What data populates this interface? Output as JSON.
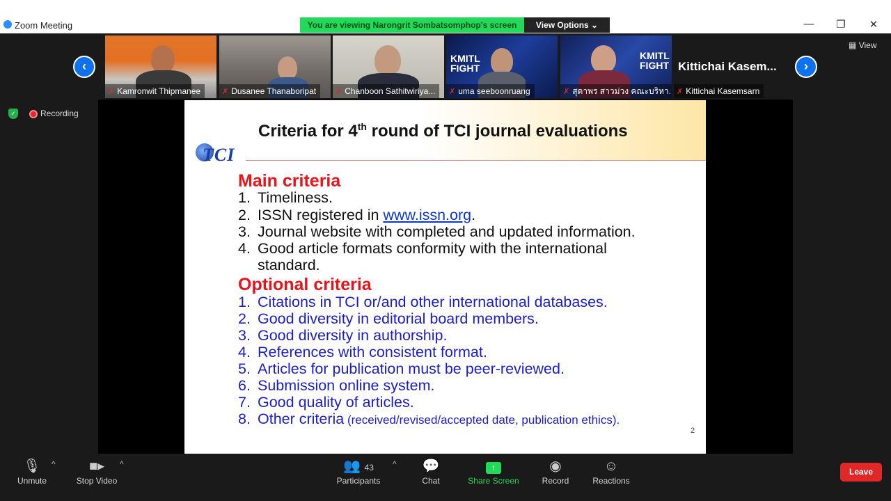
{
  "window": {
    "title": "Zoom Meeting",
    "minimize": "—",
    "restore": "❐",
    "close": "✕"
  },
  "banner": {
    "viewing": "You are viewing Narongrit Sombatsomphop's screen",
    "view_options": "View Options ⌄"
  },
  "participants_strip": [
    {
      "name": "Kamronwit Thipmanee"
    },
    {
      "name": "Dusanee Thanaboripat"
    },
    {
      "name": "Chanboon Sathitwiriya..."
    },
    {
      "name": "uma seeboonruang"
    },
    {
      "name": "สุดาพร สาวม่วง คณะบริหา..."
    },
    {
      "name": "Kittichai Kasemsarn",
      "big_label": "Kittichai  Kasem..."
    }
  ],
  "strip_controls": {
    "prev": "‹",
    "next": "›",
    "view": "View"
  },
  "tile_texts": {
    "tile4_logo": "KMITL FIGHT",
    "tile5_logo": "KMITL FIGHT"
  },
  "recording": {
    "label": "Recording"
  },
  "slide": {
    "title_pre": "Criteria for 4",
    "title_sup": "th",
    "title_post": " round of TCI journal evaluations",
    "logo_text": "TCI",
    "main_heading": "Main criteria",
    "main_items": [
      {
        "num": "1.",
        "text": "Timeliness."
      },
      {
        "num": "2.",
        "text_pre": "ISSN registered in ",
        "link": "www.issn.org",
        "text_post": "."
      },
      {
        "num": "3.",
        "text": "Journal website with completed and updated information."
      },
      {
        "num": "4.",
        "text": "Good article formats conformity with the international"
      },
      {
        "num": "",
        "text": "standard."
      }
    ],
    "optional_heading": "Optional criteria",
    "optional_items": [
      {
        "num": "1.",
        "text": "Citations in TCI or/and other international databases."
      },
      {
        "num": "2.",
        "text": "Good diversity in editorial board members."
      },
      {
        "num": "3.",
        "text": "Good diversity in authorship."
      },
      {
        "num": "4.",
        "text": "References with consistent format."
      },
      {
        "num": "5.",
        "text": "Articles for publication must be peer-reviewed."
      },
      {
        "num": "6.",
        "text": "Submission online system."
      },
      {
        "num": "7.",
        "text": "Good quality of articles."
      },
      {
        "num": "8.",
        "text": "Other criteria",
        "small": " (received/revised/accepted date, publication ethics)."
      }
    ],
    "page_number": "2"
  },
  "toolbar": {
    "unmute": "Unmute",
    "stop_video": "Stop Video",
    "participants": "Participants",
    "participant_count": "43",
    "chat": "Chat",
    "share_screen": "Share Screen",
    "record": "Record",
    "reactions": "Reactions",
    "leave": "Leave"
  },
  "colors": {
    "banner_green": "#23d959",
    "accent_blue": "#0e72ed",
    "leave_red": "#e02828",
    "heading_red": "#e8141b",
    "optional_blue": "#1c1cc8"
  },
  "icons": {
    "mic": "mic-muted-icon",
    "video": "video-camera-icon",
    "participants": "participants-icon",
    "chat": "chat-bubble-icon",
    "share": "share-screen-icon",
    "record": "record-icon",
    "reactions": "reactions-icon"
  }
}
